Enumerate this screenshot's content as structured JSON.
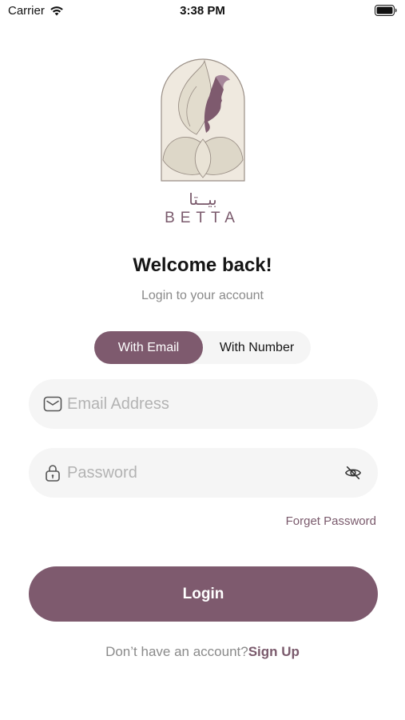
{
  "status_bar": {
    "carrier": "Carrier",
    "time": "3:38 PM"
  },
  "brand": {
    "arabic_mark": "بيــتا",
    "name": "BETTA"
  },
  "header": {
    "title": "Welcome back!",
    "subtitle": "Login to your account"
  },
  "login_mode": {
    "options": [
      "With Email",
      "With Number"
    ],
    "selected": "With Email"
  },
  "form": {
    "email_placeholder": "Email Address",
    "email_value": "",
    "password_placeholder": "Password",
    "password_value": "",
    "forget_password": "Forget Password",
    "submit_label": "Login"
  },
  "footer": {
    "prompt": "Don’t have an account?",
    "signup_link": "Sign Up"
  },
  "colors": {
    "brand": "#7e5a6e",
    "field_bg": "#f5f5f5",
    "logo_beige": "#ddd7c8",
    "muted_text": "#8a8a8a"
  },
  "icons": [
    "wifi-icon",
    "battery-icon",
    "envelope-icon",
    "lock-icon",
    "eye-off-icon"
  ]
}
